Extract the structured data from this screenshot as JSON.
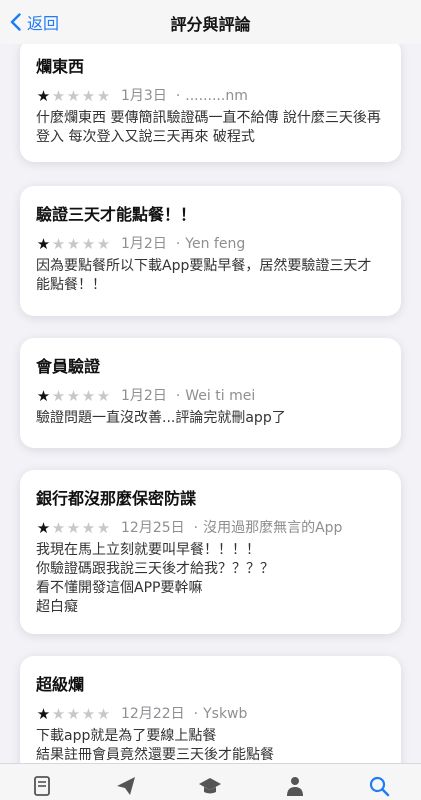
{
  "navbar": {
    "back_label": "返回",
    "title": "評分與評論"
  },
  "reviews": [
    {
      "title": "爛東西",
      "stars": 1,
      "date": "1月3日",
      "author": ".........nm",
      "text": "什麼爛東西 要傳簡訊驗證碼一直不給傳 說什麼三天後再登入 每次登入又說三天再來 破程式"
    },
    {
      "title": "驗證三天才能點餐！！",
      "stars": 1,
      "date": "1月2日",
      "author": "Yen feng",
      "text": "因為要點餐所以下載App要點早餐，居然要驗證三天才能點餐！！"
    },
    {
      "title": "會員驗證",
      "stars": 1,
      "date": "1月2日",
      "author": "Wei ti mei",
      "text": "驗證問題一直沒改善...評論完就刪app了"
    },
    {
      "title": "銀行都沒那麼保密防諜",
      "stars": 1,
      "date": "12月25日",
      "author": "沒用過那麼無言的App",
      "text": "我現在馬上立刻就要叫早餐！！！！\n你驗證碼跟我說三天後才給我？？？？\n看不懂開發這個APP要幹嘛\n超白癡"
    },
    {
      "title": "超級爛",
      "stars": 1,
      "date": "12月22日",
      "author": "Yskwb",
      "text": "下載app就是為了要線上點餐\n結果註冊會員竟然還要三天後才能點餐\n也太不方便了吧"
    }
  ],
  "tabbar": {
    "icons": [
      "document-icon",
      "paper-plane-icon",
      "graduation-cap-icon",
      "person-icon",
      "search-icon"
    ]
  },
  "colors": {
    "accent": "#1f7cf5",
    "background": "#f2f2f7",
    "star_filled": "#111111",
    "star_empty": "#c8c8cc"
  }
}
